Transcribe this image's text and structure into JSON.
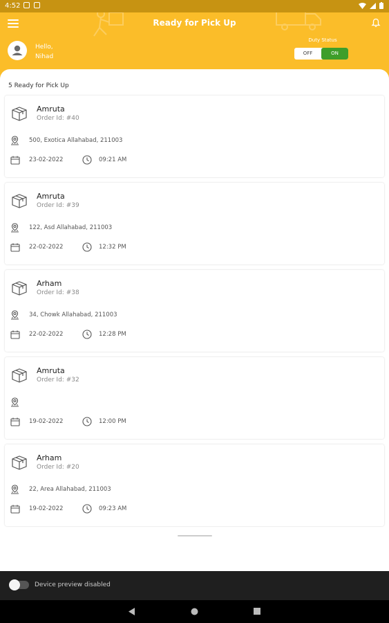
{
  "status_bar": {
    "time": "4:52"
  },
  "header": {
    "title": "Ready for Pick Up",
    "greeting": "Hello,",
    "user_name": "Nihad",
    "duty_status_label": "Duty Status",
    "toggle_off": "OFF",
    "toggle_on": "ON",
    "duty_on": true
  },
  "list": {
    "count_label": "5 Ready for Pick Up",
    "orders": [
      {
        "name": "Amruta",
        "order_id": "Order Id: #40",
        "address": "500, Exotica Allahabad, 211003",
        "date": "23-02-2022",
        "time": "09:21 AM"
      },
      {
        "name": "Amruta",
        "order_id": "Order Id: #39",
        "address": "122, Asd Allahabad, 211003",
        "date": "22-02-2022",
        "time": "12:32 PM"
      },
      {
        "name": "Arham",
        "order_id": "Order Id: #38",
        "address": "34, Chowk Allahabad, 211003",
        "date": "22-02-2022",
        "time": "12:28 PM"
      },
      {
        "name": "Amruta",
        "order_id": "Order Id: #32",
        "address": "",
        "date": "19-02-2022",
        "time": "12:00 PM"
      },
      {
        "name": "Arham",
        "order_id": "Order Id: #20",
        "address": "22, Area Allahabad, 211003",
        "date": "19-02-2022",
        "time": "09:23 AM"
      }
    ]
  },
  "device_preview": {
    "label": "Device preview disabled"
  },
  "colors": {
    "accent": "#fbbd29",
    "on_green": "#3e9e2a"
  }
}
